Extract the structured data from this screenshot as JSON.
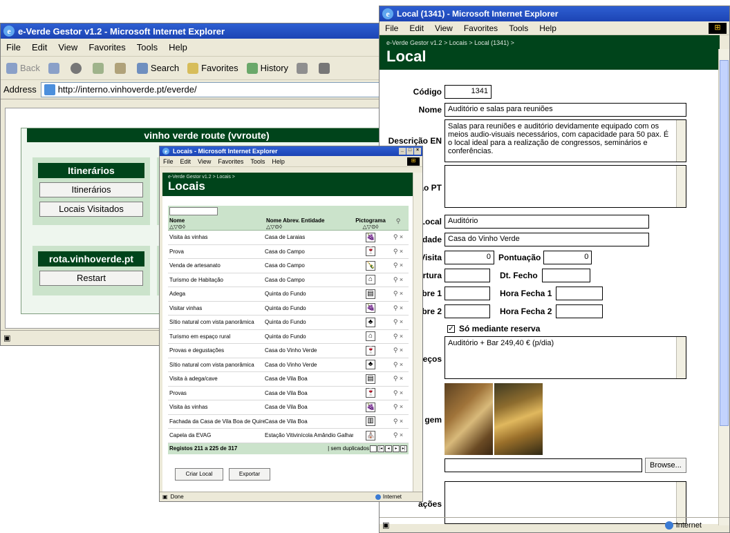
{
  "gestor": {
    "title": "e-Verde Gestor v1.2 - Microsoft Internet Explorer",
    "menu": [
      "File",
      "Edit",
      "View",
      "Favorites",
      "Tools",
      "Help"
    ],
    "toolbar": {
      "back": "Back",
      "search": "Search",
      "favorites": "Favorites",
      "history": "History"
    },
    "address_label": "Address",
    "address_url": "http://interno.vinhoverde.pt/everde/",
    "banner": "vinho verde route (vvroute)",
    "panel_itinerarios": {
      "title": "Itinerários",
      "buttons": [
        "Itinerários",
        "Locais Visitados"
      ]
    },
    "panel_rota": {
      "title": "rota.vinhoverde.pt",
      "buttons": [
        "Restart"
      ]
    }
  },
  "local": {
    "title": "Local (1341) - Microsoft Internet Explorer",
    "menu": [
      "File",
      "Edit",
      "View",
      "Favorites",
      "Tools",
      "Help"
    ],
    "breadcrumb": "e-Verde Gestor v1.2 > Locais > Local (1341) >",
    "heading": "Local",
    "fields": {
      "codigo_label": "Código",
      "codigo": "1341",
      "nome_label": "Nome",
      "nome": "Auditório e salas  para reuniões",
      "descricao_en_label": "Descrição EN",
      "descricao_en": "Salas para reuniões e auditório devidamente equipado com os meios audio-visuais necessários, com capacidade para 50 pax. É o local ideal para a realização de congressos, seminários e conferências.",
      "descricao_pt_label": "ão PT",
      "local_label": "Local",
      "local": "Auditório",
      "entidade_label": "dade",
      "entidade": "Casa do Vinho Verde",
      "visita_label": "Visita",
      "visita": "0",
      "pontuacao_label": "Pontuação",
      "pontuacao": "0",
      "abertura_label": "rtura",
      "dt_fecho_label": "Dt. Fecho",
      "abre1_label": "bre 1",
      "hora_fecha1_label": "Hora Fecha 1",
      "abre2_label": "bre 2",
      "hora_fecha2_label": "Hora Fecha 2",
      "reserva_label": "Só mediante reserva",
      "precos_label": "reços",
      "precos": "Auditório + Bar 249,40 € (p/dia)",
      "imagem_label": "gem",
      "browse": "Browse...",
      "observacoes_label": "ações"
    },
    "status": "Internet"
  },
  "locais": {
    "title": "Locais - Microsoft Internet Explorer",
    "menu": [
      "File",
      "Edit",
      "View",
      "Favorites",
      "Tools",
      "Help"
    ],
    "breadcrumb": "e-Verde Gestor v1.2 > Locais >",
    "heading": "Locais",
    "columns": {
      "nome": "Nome",
      "entidade": "Nome Abrev. Entidade",
      "pictograma": "Pictograma"
    },
    "rows": [
      {
        "nome": "Visita às vinhas",
        "entidade": "Casa de Laraias",
        "icon": "grapes-icon",
        "glyph": "🍇"
      },
      {
        "nome": "Prova",
        "entidade": "Casa do Campo",
        "icon": "glass-icon",
        "glyph": "🍷"
      },
      {
        "nome": "Venda de artesanato",
        "entidade": "Casa do Campo",
        "icon": "bottle-icon",
        "glyph": "🍾"
      },
      {
        "nome": "Turismo de Habitação",
        "entidade": "Casa do Campo",
        "icon": "house-icon",
        "glyph": "⌂"
      },
      {
        "nome": "Adega",
        "entidade": "Quinta do Fundo",
        "icon": "cellar-icon",
        "glyph": "▤"
      },
      {
        "nome": "Visitar vinhas",
        "entidade": "Quinta do Fundo",
        "icon": "grapes-icon",
        "glyph": "🍇"
      },
      {
        "nome": "Sítio natural com vista panorâmica",
        "entidade": "Quinta do Fundo",
        "icon": "trees-icon",
        "glyph": "♣"
      },
      {
        "nome": "Turismo em espaço rural",
        "entidade": "Quinta do Fundo",
        "icon": "house-icon",
        "glyph": "⌂"
      },
      {
        "nome": "Provas e degustações",
        "entidade": "Casa do Vinho Verde",
        "icon": "glass-icon",
        "glyph": "🍷"
      },
      {
        "nome": "Sítio natural com vista panorâmica",
        "entidade": "Casa do Vinho Verde",
        "icon": "trees-icon",
        "glyph": "♣"
      },
      {
        "nome": "Visita à adega/cave",
        "entidade": "Casa de Vila Boa",
        "icon": "cellar-icon",
        "glyph": "▤"
      },
      {
        "nome": "Provas",
        "entidade": "Casa de Vila Boa",
        "icon": "glass-icon",
        "glyph": "🍷"
      },
      {
        "nome": "Visita às vinhas",
        "entidade": "Casa de Vila Boa",
        "icon": "grapes-icon",
        "glyph": "🍇"
      },
      {
        "nome": "Fachada da Casa de Vila Boa de Quires",
        "entidade": "Casa de Vila Boa",
        "icon": "facade-icon",
        "glyph": "▥"
      },
      {
        "nome": "Capela da EVAG",
        "entidade": "Estação Vitivinícola Amândio Galhano",
        "icon": "chapel-icon",
        "glyph": "⛪"
      }
    ],
    "footer": {
      "registos": "Registos 211 a 225 de 317",
      "sem_duplicados": "| sem duplicados"
    },
    "buttons": {
      "criar": "Criar Local",
      "exportar": "Exportar"
    },
    "status_done": "Done",
    "status_zone": "Internet"
  }
}
